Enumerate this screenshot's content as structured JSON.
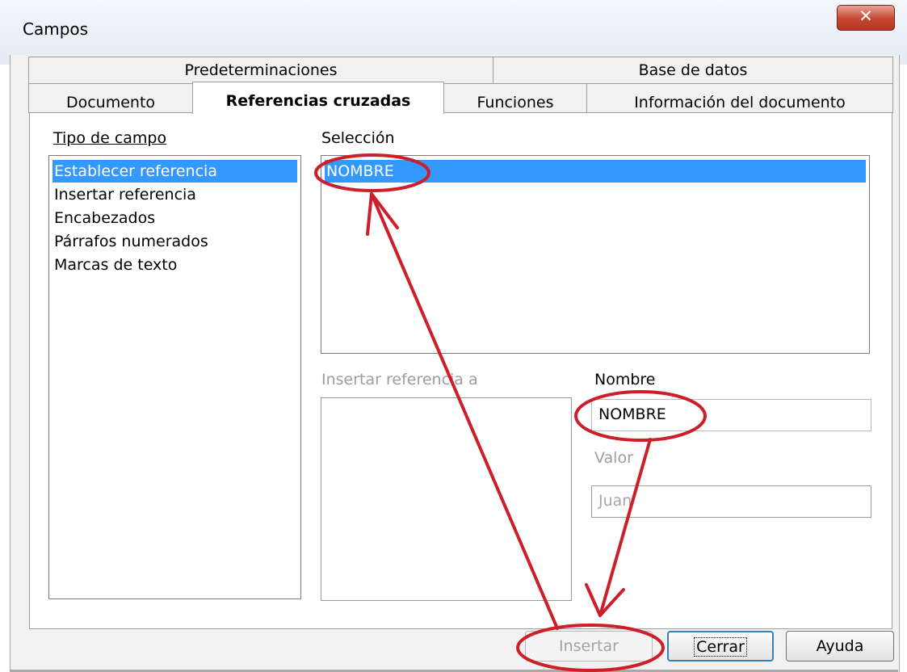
{
  "window": {
    "title": "Campos",
    "close_label": "✕"
  },
  "tabs": {
    "top": [
      "Predeterminaciones",
      "Base de datos"
    ],
    "bottom": [
      "Documento",
      "Referencias cruzadas",
      "Funciones",
      "Información del documento"
    ],
    "active": "Referencias cruzadas"
  },
  "tipo_de_campo": {
    "label": "Tipo de campo",
    "items": [
      "Establecer referencia",
      "Insertar referencia",
      "Encabezados",
      "Párrafos numerados",
      "Marcas de texto"
    ],
    "selected": "Establecer referencia"
  },
  "seleccion": {
    "label": "Selección",
    "items": [
      "NOMBRE"
    ],
    "selected": "NOMBRE"
  },
  "insertar_referencia": {
    "label": "Insertar referencia a",
    "items": []
  },
  "nombre": {
    "label": "Nombre",
    "value": "NOMBRE"
  },
  "valor": {
    "label": "Valor",
    "value": "Juan"
  },
  "buttons": {
    "insertar": "Insertar",
    "cerrar": "Cerrar",
    "ayuda": "Ayuda"
  },
  "colors": {
    "selection": "#3399ff",
    "annotation": "#cc1f2a"
  }
}
